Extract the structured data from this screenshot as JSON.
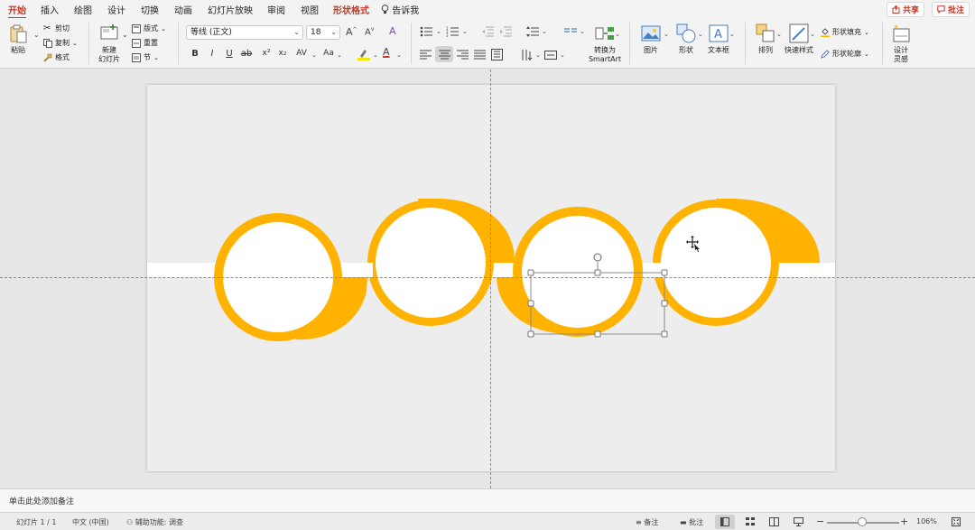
{
  "tabs": [
    "开始",
    "插入",
    "绘图",
    "设计",
    "切换",
    "动画",
    "幻灯片放映",
    "审阅",
    "视图",
    "形状格式"
  ],
  "tell_me": "告诉我",
  "share_label": "共享",
  "comment_label": "批注",
  "ribbon": {
    "paste": "粘贴",
    "cut": "剪切",
    "copy": "复制",
    "format_painter": "格式",
    "new_slide_line1": "新建",
    "new_slide_line2": "幻灯片",
    "layout": "版式",
    "reset": "重置",
    "section": "节",
    "font_name": "等线 (正文)",
    "font_size": "18",
    "bold": "B",
    "italic": "I",
    "underline": "U",
    "strike": "ab",
    "superscript": "x²",
    "subscript": "x₂",
    "char_spacing": "AV",
    "change_case": "Aa",
    "convert_smartart_line1": "转换为",
    "convert_smartart_line2": "SmartArt",
    "picture": "图片",
    "shape": "形状",
    "textbox": "文本框",
    "arrange": "排列",
    "quick_styles": "快速样式",
    "shape_fill": "形状填充",
    "shape_outline": "形状轮廓",
    "designer_line1": "设计",
    "designer_line2": "灵感"
  },
  "notes_placeholder": "单击此处添加备注",
  "status": {
    "slide_info": "幻灯片 1 / 1",
    "language": "中文 (中国)",
    "accessibility": "辅助功能: 调查",
    "notes": "备注",
    "comments": "批注",
    "zoom": "106%"
  },
  "colors": {
    "accent_red": "#c0392b",
    "shape_orange": "#ffb300",
    "slide_bg": "#ededed"
  }
}
